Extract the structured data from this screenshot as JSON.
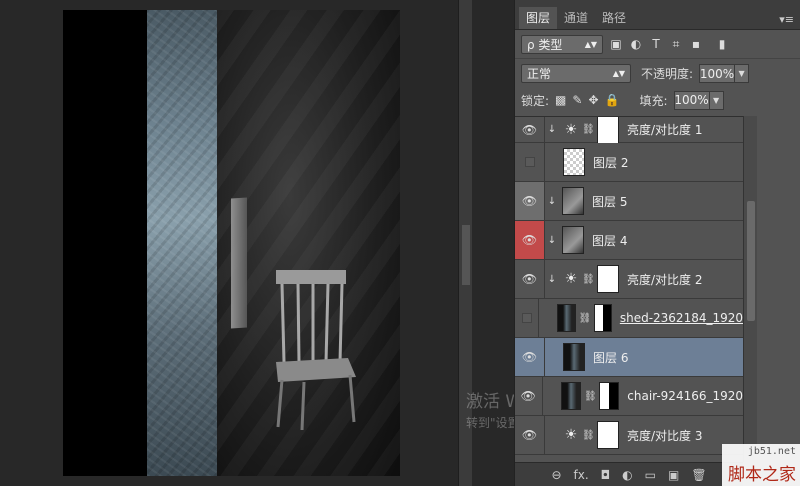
{
  "canvas": {
    "description_hidden": ""
  },
  "watermark": {
    "line1": "激活 Windows",
    "line2": "转到\"设置\"以激活 Windows"
  },
  "panel": {
    "tabs": [
      "图层",
      "通道",
      "路径"
    ],
    "filter_label": "ρ 类型",
    "filter_icons": [
      "▣",
      "◐",
      "T",
      "⌗",
      "▪"
    ],
    "blend_mode": "正常",
    "opacity_label": "不透明度:",
    "opacity_value": "100%",
    "lock_label": "锁定:",
    "fill_label": "填充:",
    "fill_value": "100%",
    "layers": [
      {
        "name": "亮度/对比度 1",
        "visible": true,
        "type": "adjustment",
        "clipped": true
      },
      {
        "name": "图层 2",
        "visible": false,
        "type": "pixel",
        "clipped": false
      },
      {
        "name": "图层 5",
        "visible": true,
        "type": "pixel",
        "clipped": true
      },
      {
        "name": "图层 4",
        "visible": true,
        "type": "pixel",
        "clipped": true,
        "eye_color": "#c24a4a"
      },
      {
        "name": "亮度/对比度 2",
        "visible": true,
        "type": "adjustment",
        "clipped": true
      },
      {
        "name": "shed-2362184_1920",
        "visible": false,
        "type": "masked",
        "clipped": false
      },
      {
        "name": "图层 6",
        "visible": true,
        "type": "pixel",
        "clipped": false,
        "selected": true
      },
      {
        "name": "chair-924166_1920",
        "visible": true,
        "type": "masked",
        "clipped": false
      },
      {
        "name": "亮度/对比度 3",
        "visible": true,
        "type": "adjustment",
        "clipped": false
      }
    ],
    "bottom_icons": [
      "⊖",
      "fx.",
      "◘",
      "◐",
      "▭",
      "▣",
      "🗑"
    ]
  },
  "site_logo": {
    "url": "jb51.net",
    "name": "脚本之家"
  }
}
